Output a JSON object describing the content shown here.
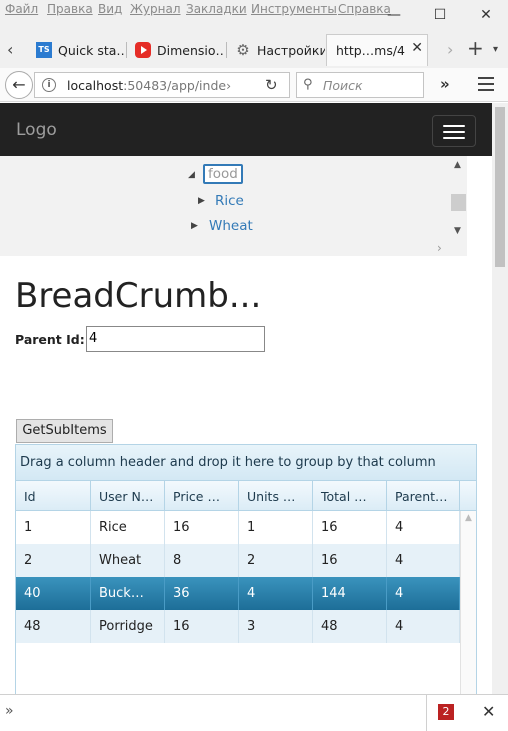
{
  "browser": {
    "menu": [
      "Файл",
      "Правка",
      "Вид",
      "Журнал",
      "Закладки",
      "Инструменты",
      "Справка"
    ],
    "window_controls": {
      "minimize": "—",
      "maximize": "☐",
      "close": "✕"
    },
    "tabs": [
      {
        "label": "Quick sta…",
        "icon": "typescript-icon"
      },
      {
        "label": "Dimensio…",
        "icon": "youtube-icon"
      },
      {
        "label": "Настройки",
        "icon": "gear-icon"
      },
      {
        "label": "http…ms/4",
        "icon": "",
        "active": true
      }
    ],
    "url": {
      "host": "localhost",
      "rest": ":50483/app/inde›"
    },
    "search_placeholder": "Поиск",
    "notification_count": "2"
  },
  "app": {
    "logo": "Logo",
    "tree": {
      "root": "food",
      "children": [
        "Rice",
        "Wheat"
      ]
    },
    "page_title": "BreadCrumb...",
    "parent_label": "Parent Id:",
    "parent_value": "4",
    "button_label": "GetSubItems",
    "grid": {
      "group_hint": "Drag a column header and drop it here to group by that column",
      "columns": [
        "Id",
        "User N…",
        "Price …",
        "Units …",
        "Total …",
        "Parent…"
      ],
      "rows": [
        [
          "1",
          "Rice",
          "16",
          "1",
          "16",
          "4"
        ],
        [
          "2",
          "Wheat",
          "8",
          "2",
          "16",
          "4"
        ],
        [
          "40",
          "Buck…",
          "36",
          "4",
          "144",
          "4"
        ],
        [
          "48",
          "Porridge",
          "16",
          "3",
          "48",
          "4"
        ]
      ],
      "selected_row": 2
    }
  }
}
